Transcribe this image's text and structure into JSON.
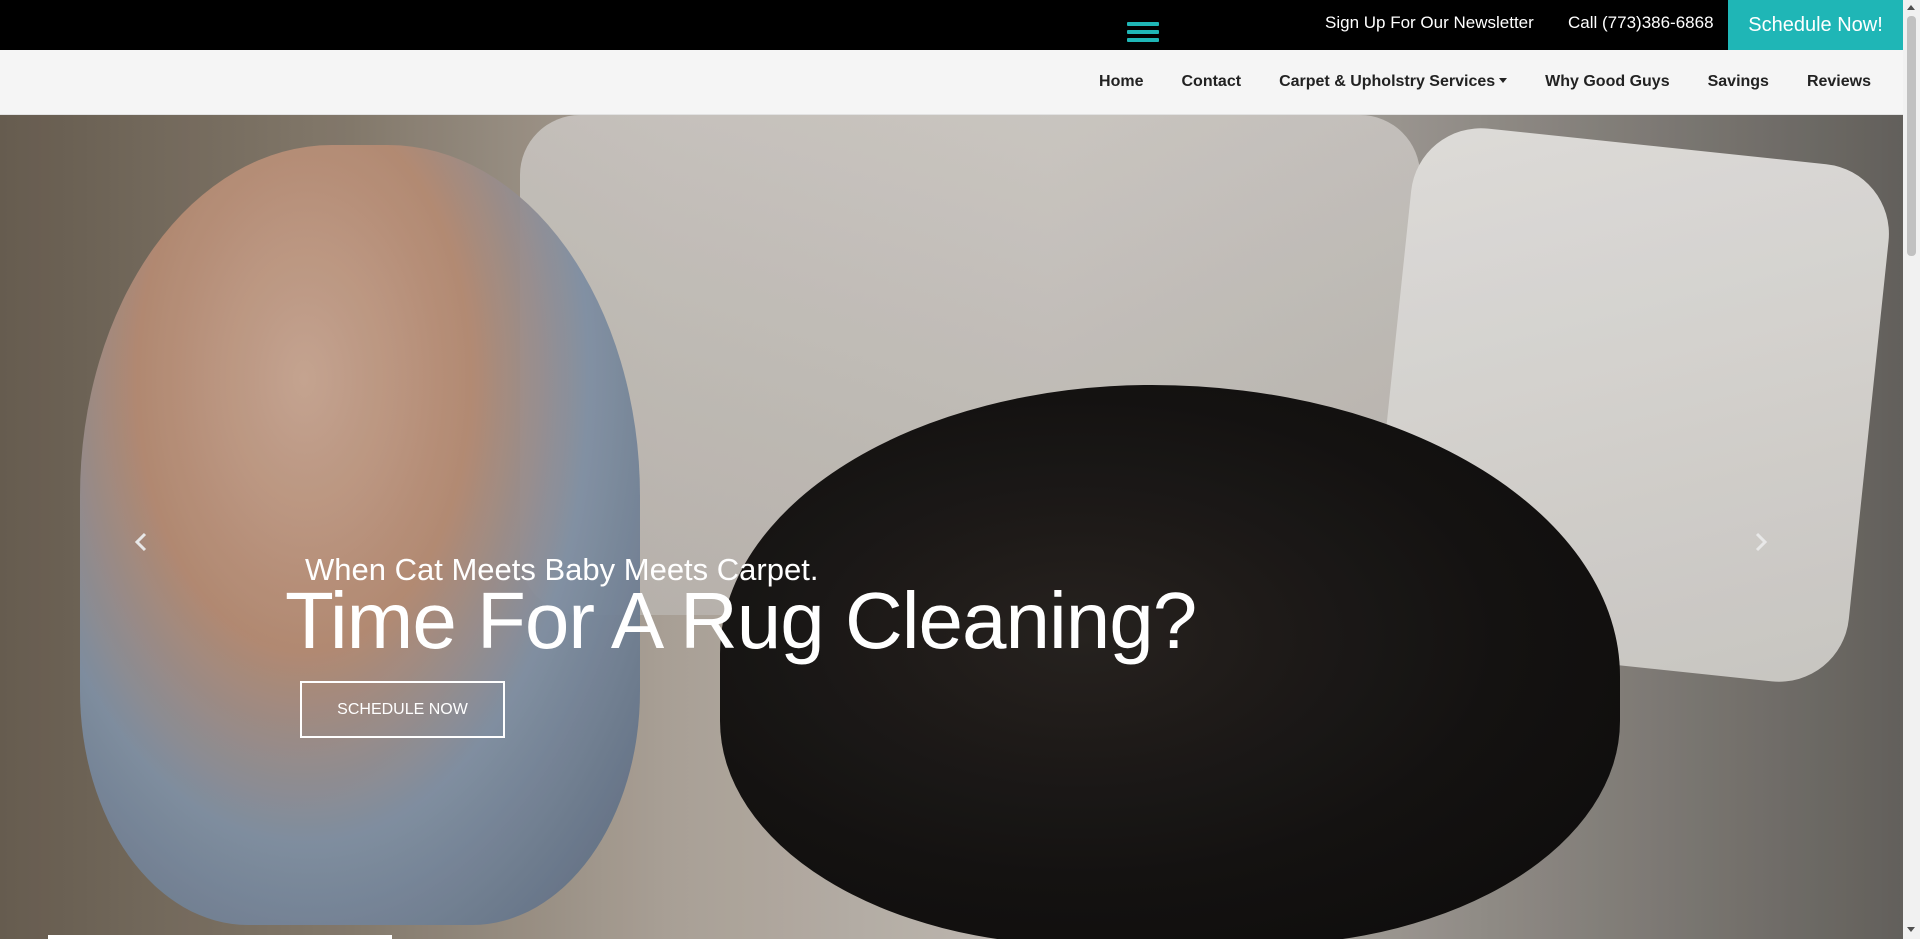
{
  "topbar": {
    "newsletter_label": "Sign Up For Our Newsletter",
    "phone_label": "Call (773)386-6868",
    "schedule_label": "Schedule Now!",
    "accent_color": "#1fb6b6",
    "menu_icon": "hamburger-menu-icon"
  },
  "nav": {
    "items": [
      {
        "label": "Home"
      },
      {
        "label": "Contact"
      },
      {
        "label": "Carpet & Upholstry Services",
        "has_dropdown": true
      },
      {
        "label": "Why Good Guys"
      },
      {
        "label": "Savings"
      },
      {
        "label": "Reviews"
      }
    ]
  },
  "hero": {
    "subtitle": "When Cat Meets Baby Meets Carpet.",
    "title": "Time For A Rug Cleaning?",
    "cta_label": "SCHEDULE NOW",
    "prev_icon": "chevron-left-icon",
    "next_icon": "chevron-right-icon"
  }
}
